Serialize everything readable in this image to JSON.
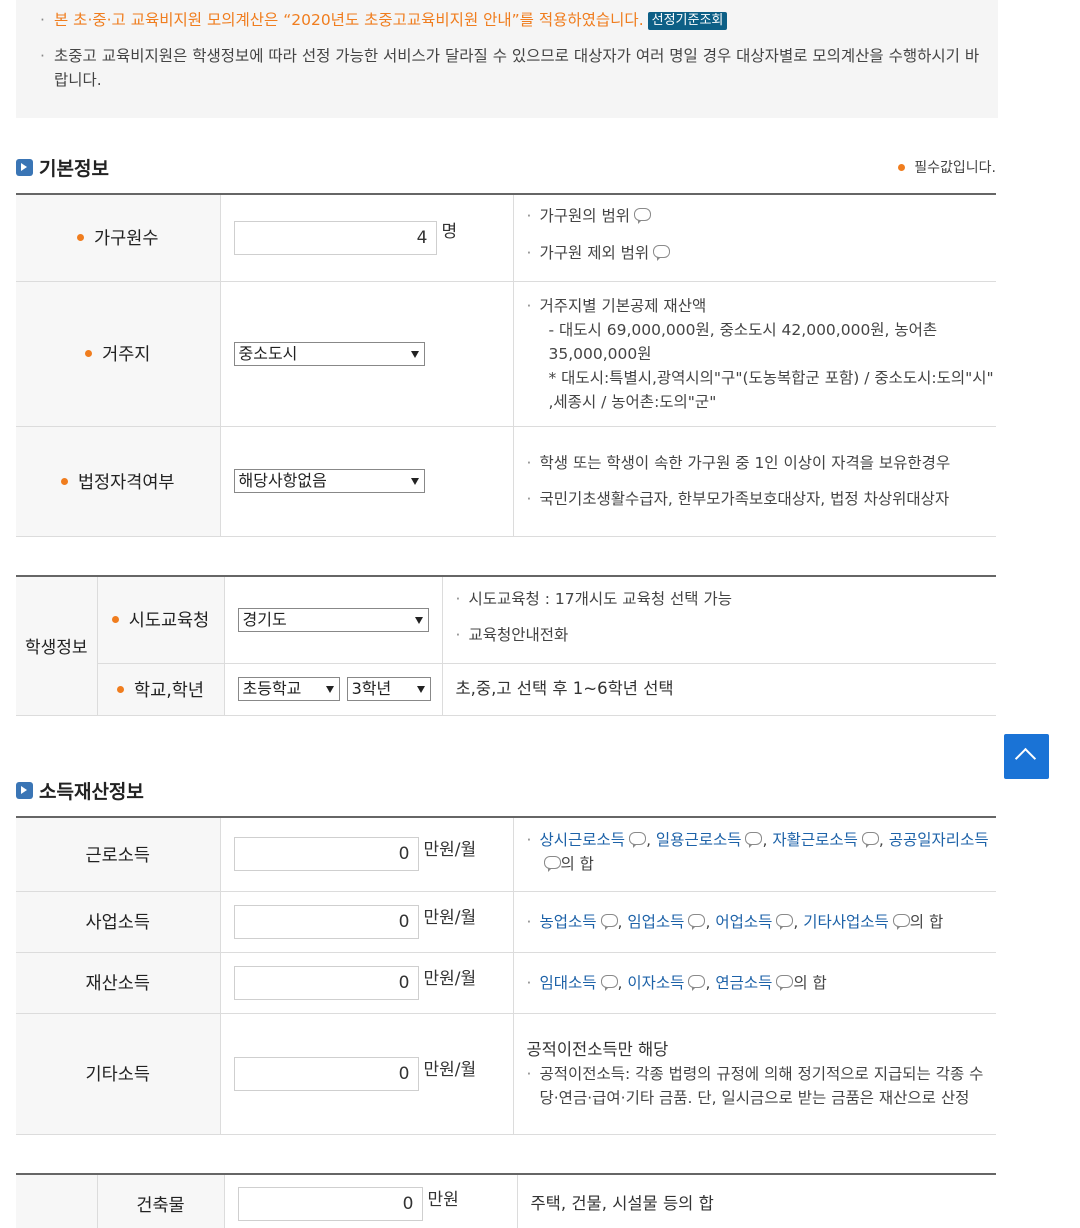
{
  "notice": {
    "line1": "본 초·중·고 교육비지원 모의계산은 “2020년도 초중고교육비지원 안내”를 적용하였습니다.",
    "badge": "선정기준조회",
    "line2": "초중고 교육비지원은 학생정보에 따라 선정 가능한 서비스가 달라질 수 있으므로 대상자가 여러 명일 경우 대상자별로 모의계산을 수행하시기 바랍니다."
  },
  "basic": {
    "title": "기본정보",
    "required_note": "필수값입니다.",
    "household": {
      "label": "가구원수",
      "value": "4",
      "unit": "명",
      "desc1": "가구원의 범위",
      "desc2": "가구원 제외 범위"
    },
    "residence": {
      "label": "거주지",
      "selected": "중소도시",
      "desc_title": "거주지별 기본공제 재산액",
      "desc_line1": "- 대도시 69,000,000원, 중소도시 42,000,000원, 농어촌 35,000,000원",
      "desc_line2": "* 대도시:특별시,광역시의\"구\"(도농복합군 포함) / 중소도시:도의\"시\" ,세종시 / 농어촌:도의\"군\""
    },
    "legal": {
      "label": "법정자격여부",
      "selected": "해당사항없음",
      "desc1": "학생 또는 학생이 속한 가구원 중 1인 이상이 자격을 보유한경우",
      "desc2": "국민기초생활수급자, 한부모가족보호대상자, 법정 차상위대상자"
    }
  },
  "student": {
    "group_label": "학생정보",
    "office": {
      "label": "시도교육청",
      "selected": "경기도",
      "desc1": "시도교육청 : 17개시도 교육청 선택 가능",
      "desc2": "교육청안내전화"
    },
    "school": {
      "label": "학교,학년",
      "school_selected": "초등학교",
      "grade_selected": "3학년",
      "desc": "초,중,고 선택 후 1~6학년 선택"
    }
  },
  "income": {
    "title": "소득재산정보",
    "unit": "만원/월",
    "labor": {
      "label": "근로소득",
      "value": "0",
      "i1": "상시근로소득",
      "i2": "일용근로소득",
      "i3": "자활근로소득",
      "i4": "공공일자리소득",
      "suffix": "의 합"
    },
    "business": {
      "label": "사업소득",
      "value": "0",
      "i1": "농업소득",
      "i2": "임업소득",
      "i3": "어업소득",
      "i4": "기타사업소득",
      "suffix": "의 합"
    },
    "property": {
      "label": "재산소득",
      "value": "0",
      "i1": "임대소득",
      "i2": "이자소득",
      "i3": "연금소득",
      "suffix": "의 합"
    },
    "other": {
      "label": "기타소득",
      "value": "0",
      "desc_title": "공적이전소득만 해당",
      "desc_body": "공적이전소득: 각종 법령의 규정에 의해 정기적으로 지급되는 각종 수당·연금·급여·기타 금품. 단, 일시금으로 받는 금품은 재산으로 산정"
    }
  },
  "assets": {
    "building": {
      "label": "건축물",
      "value": "0",
      "unit": "만원",
      "desc": "주택, 건물, 시설물 등의 합"
    }
  }
}
